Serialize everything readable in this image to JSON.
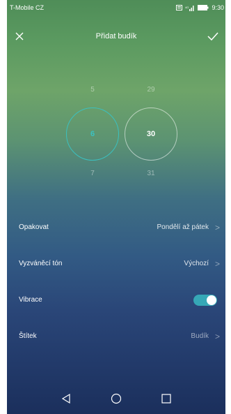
{
  "status_bar": {
    "carrier": "T-Mobile CZ",
    "time": "9:30",
    "icons": [
      "notification-icon",
      "signal-icon",
      "battery-icon"
    ]
  },
  "header": {
    "title": "Přidat budík",
    "close_icon": "close-icon",
    "confirm_icon": "check-icon"
  },
  "picker": {
    "hours": {
      "prev": "5",
      "selected": "6",
      "next": "7"
    },
    "minutes": {
      "prev": "29",
      "selected": "30",
      "next": "31"
    },
    "accent_color": "#3bc1c0"
  },
  "settings": {
    "repeat": {
      "label": "Opakovat",
      "value": "Pondělí až pátek"
    },
    "ringtone": {
      "label": "Vyzváněcí tón",
      "value": "Výchozí"
    },
    "vibration": {
      "label": "Vibrace",
      "enabled": true
    },
    "tag": {
      "label": "Štítek",
      "value": "Budík"
    }
  },
  "nav_bar": {
    "icons": [
      "back-icon",
      "home-icon",
      "recents-icon"
    ]
  }
}
